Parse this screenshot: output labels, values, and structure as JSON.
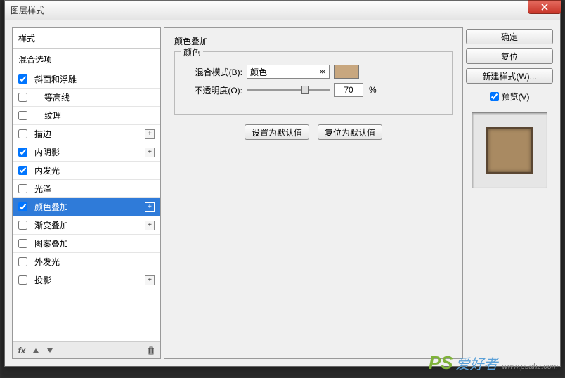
{
  "dialog": {
    "title": "图层样式"
  },
  "left": {
    "stylesHeader": "样式",
    "mixHeader": "混合选项",
    "items": [
      {
        "label": "斜面和浮雕",
        "checked": true,
        "plus": false
      },
      {
        "label": "等高线",
        "checked": false,
        "plus": false,
        "indent": true
      },
      {
        "label": "纹理",
        "checked": false,
        "plus": false,
        "indent": true
      },
      {
        "label": "描边",
        "checked": false,
        "plus": true
      },
      {
        "label": "内阴影",
        "checked": true,
        "plus": true
      },
      {
        "label": "内发光",
        "checked": true,
        "plus": false
      },
      {
        "label": "光泽",
        "checked": false,
        "plus": false
      },
      {
        "label": "颜色叠加",
        "checked": true,
        "plus": true,
        "selected": true
      },
      {
        "label": "渐变叠加",
        "checked": false,
        "plus": true
      },
      {
        "label": "图案叠加",
        "checked": false,
        "plus": false
      },
      {
        "label": "外发光",
        "checked": false,
        "plus": false
      },
      {
        "label": "投影",
        "checked": false,
        "plus": true
      }
    ],
    "footer": {
      "fx": "fx"
    }
  },
  "center": {
    "groupTitle": "颜色叠加",
    "legend": "颜色",
    "blendLabel": "混合模式(B):",
    "blendValue": "颜色",
    "opacityLabel": "不透明度(O):",
    "opacityValue": "70",
    "pct": "%",
    "setDefault": "设置为默认值",
    "resetDefault": "复位为默认值",
    "swatch": "#c8a77f"
  },
  "right": {
    "ok": "确定",
    "reset": "复位",
    "newStyle": "新建样式(W)...",
    "previewLabel": "预览(V)"
  },
  "watermark": {
    "ps": "PS",
    "cn": "爱好者",
    "url": "www.psahz.com"
  }
}
